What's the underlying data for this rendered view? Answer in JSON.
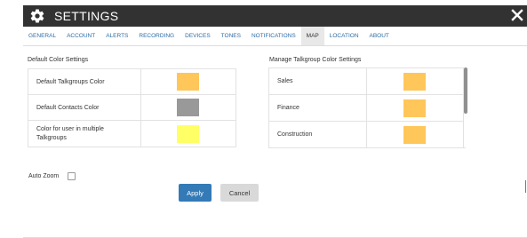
{
  "window": {
    "title": "SETTINGS",
    "icon": "gear-icon",
    "close_icon": "close-icon"
  },
  "tabs": [
    {
      "label": "GENERAL",
      "active": false
    },
    {
      "label": "ACCOUNT",
      "active": false
    },
    {
      "label": "ALERTS",
      "active": false
    },
    {
      "label": "RECORDING",
      "active": false
    },
    {
      "label": "DEVICES",
      "active": false
    },
    {
      "label": "TONES",
      "active": false
    },
    {
      "label": "NOTIFICATIONS",
      "active": false
    },
    {
      "label": "MAP",
      "active": true
    },
    {
      "label": "LOCATION",
      "active": false
    },
    {
      "label": "ABOUT",
      "active": false
    }
  ],
  "default_colors": {
    "title": "Default Color Settings",
    "rows": [
      {
        "label": "Default Talkgroups Color",
        "color": "#ffc65a"
      },
      {
        "label": "Default Contacts Color",
        "color": "#999999"
      },
      {
        "label": "Color for user in multiple Talkgroups",
        "color": "#ffff66"
      }
    ]
  },
  "talkgroup_colors": {
    "title": "Manage Talkgroup Color Settings",
    "rows": [
      {
        "label": "Sales",
        "color": "#ffc65a"
      },
      {
        "label": "Finance",
        "color": "#ffc65a"
      },
      {
        "label": "Construction",
        "color": "#ffc65a"
      }
    ]
  },
  "auto_zoom": {
    "label": "Auto Zoom",
    "checked": false
  },
  "buttons": {
    "apply": "Apply",
    "cancel": "Cancel"
  },
  "colors": {
    "titlebar": "#323232",
    "tab_link": "#2c6ca3",
    "apply_button": "#337ab7",
    "cancel_button": "#d9d9d9"
  }
}
